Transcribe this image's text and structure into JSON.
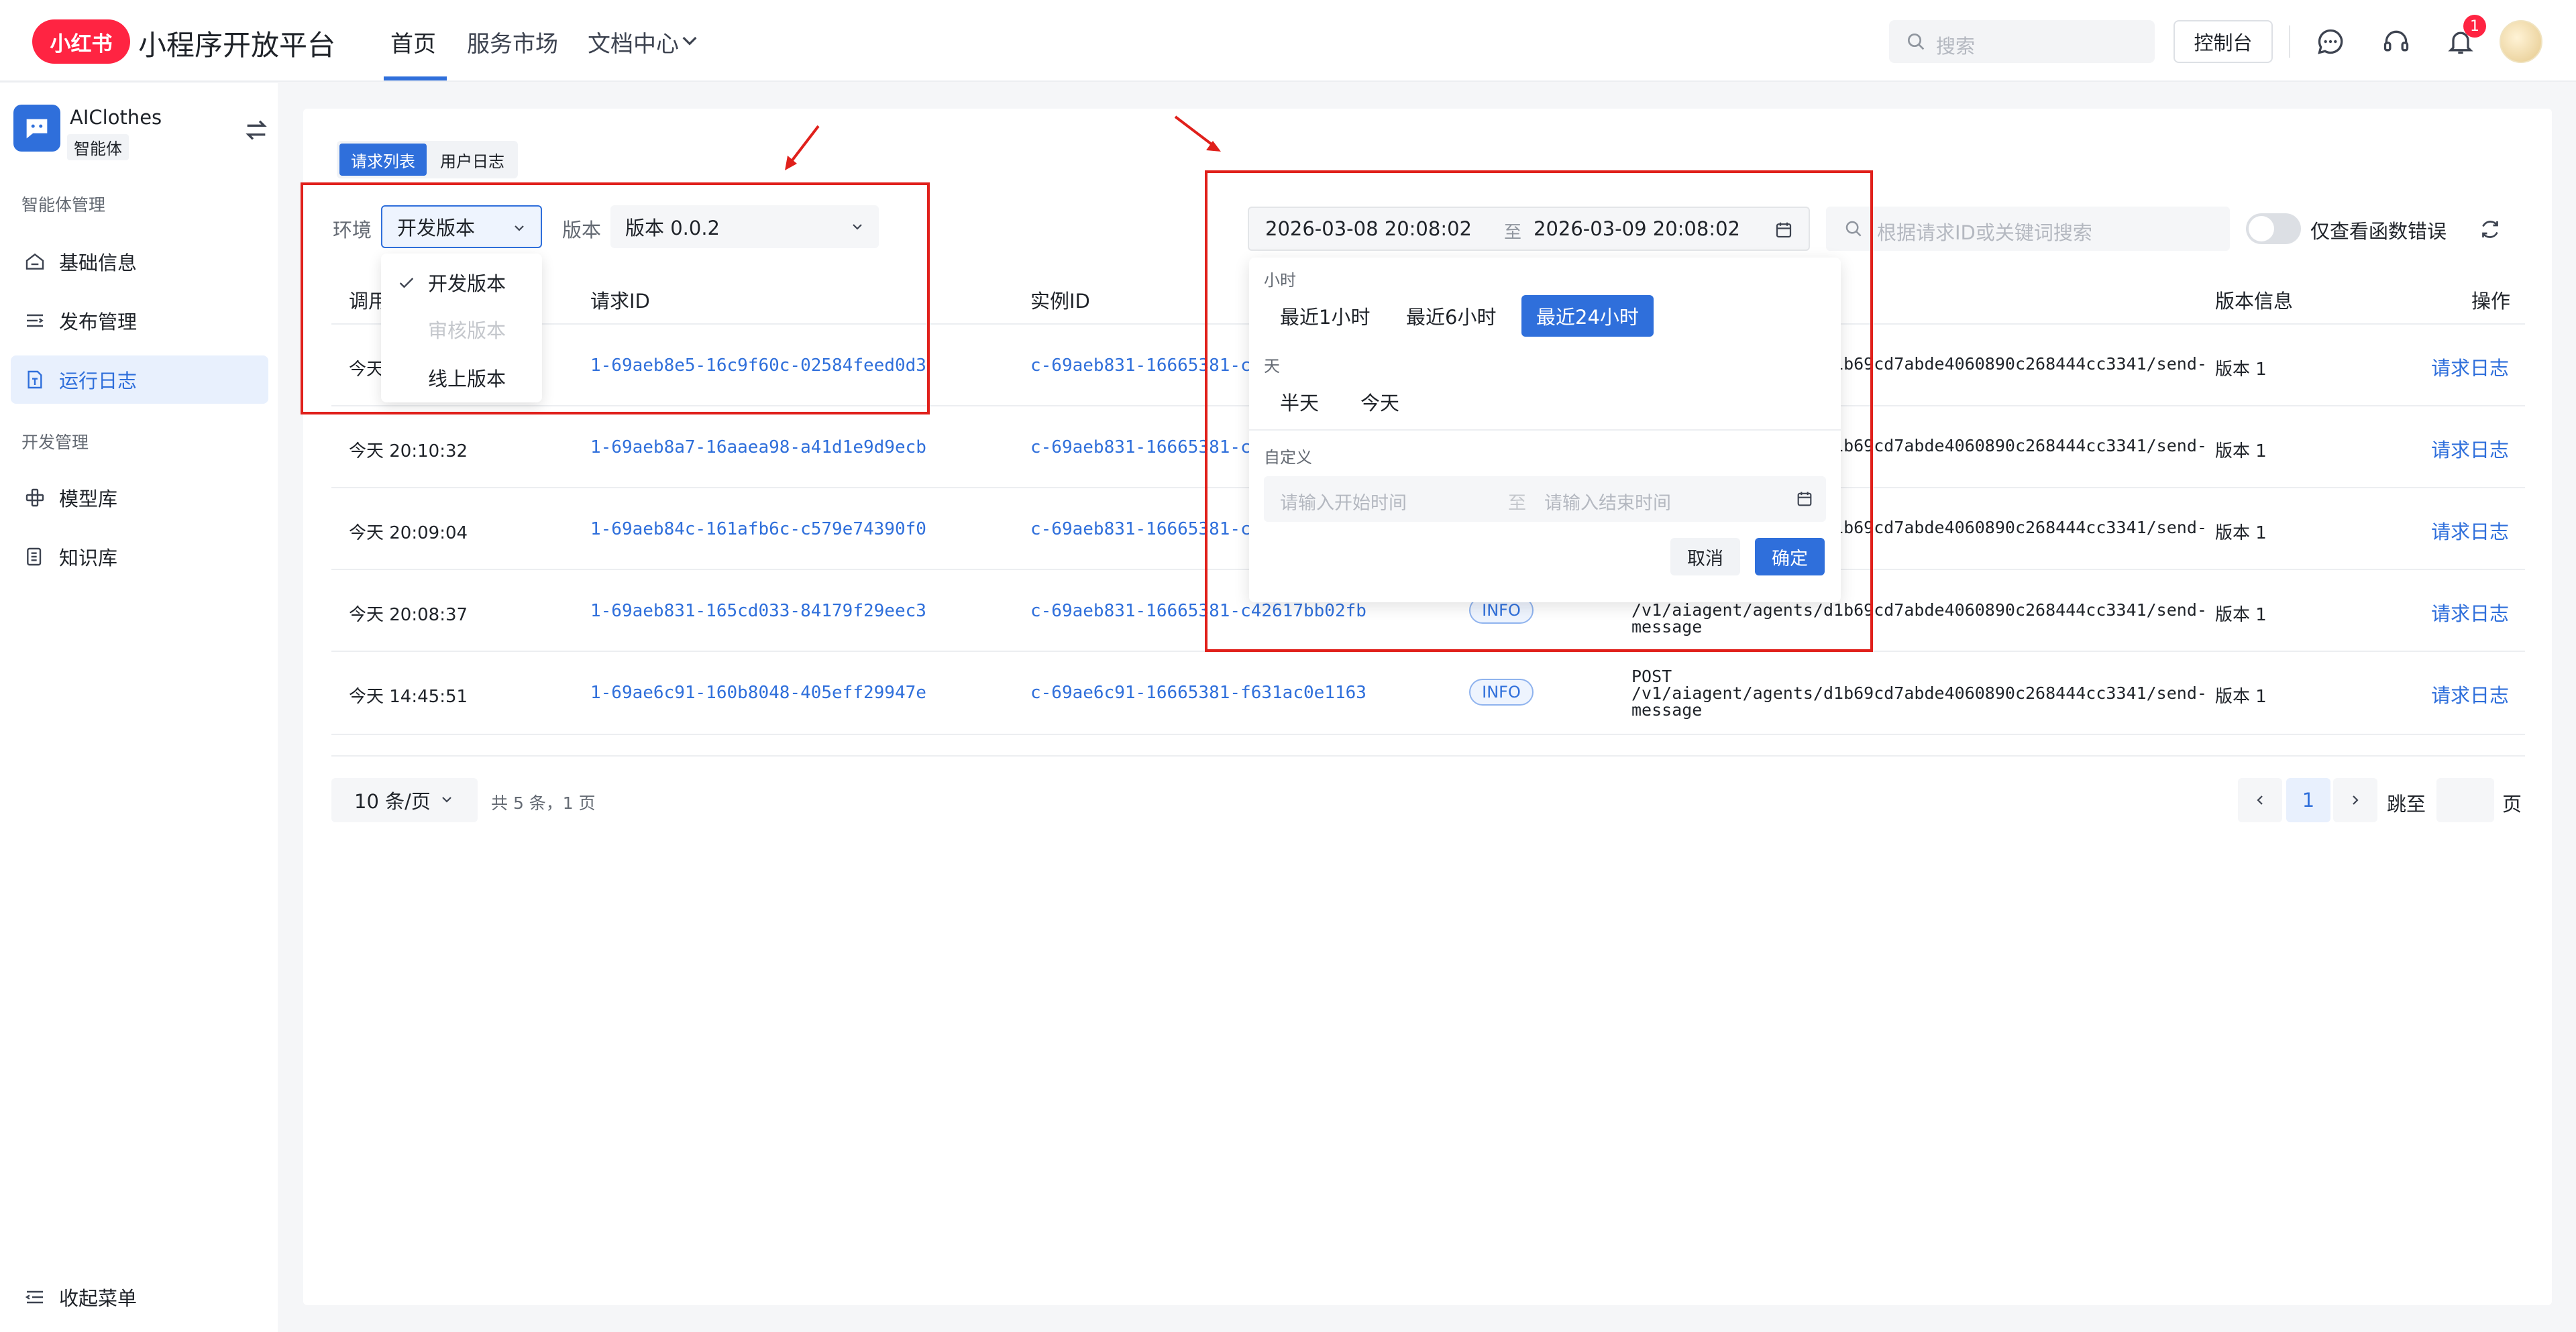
{
  "header": {
    "logo_text": "小红书",
    "platform_title": "小程序开放平台",
    "nav": [
      "首页",
      "服务市场",
      "文档中心"
    ],
    "search_placeholder": "搜索",
    "console_label": "控制台",
    "notification_count": "1"
  },
  "sidebar": {
    "agent_name": "AIClothes",
    "agent_tag": "智能体",
    "group1": "智能体管理",
    "items1": [
      "基础信息",
      "发布管理",
      "运行日志"
    ],
    "group2": "开发管理",
    "items2": [
      "模型库",
      "知识库"
    ],
    "collapse": "收起菜单"
  },
  "tabs": [
    "请求列表",
    "用户日志"
  ],
  "filters": {
    "env_label": "环境",
    "env_value": "开发版本",
    "env_options": [
      "开发版本",
      "审核版本",
      "线上版本"
    ],
    "version_label": "版本",
    "version_value": "版本 0.0.2",
    "range_start": "2026-03-08 20:08:02",
    "range_sep": "至",
    "range_end": "2026-03-09 20:08:02",
    "keyword_placeholder": "根据请求ID或关键词搜索",
    "errors_only_label": "仅查看函数错误"
  },
  "time_popup": {
    "hour_label": "小时",
    "hour_options": [
      "最近1小时",
      "最近6小时",
      "最近24小时"
    ],
    "day_label": "天",
    "day_options": [
      "半天",
      "今天"
    ],
    "custom_label": "自定义",
    "start_placeholder": "请输入开始时间",
    "sep": "至",
    "end_placeholder": "请输入结束时间",
    "cancel": "取消",
    "confirm": "确定"
  },
  "table": {
    "headers": [
      "调用结束时间",
      "请求ID",
      "实例ID",
      "版本信息",
      "操作"
    ],
    "rows": [
      {
        "time": "今天 20:11:09",
        "req": "1-69aeb8e5-16c9f60c-02584feed0d3",
        "inst": "c-69aeb831-16665381-c42617bb02fb",
        "level": "",
        "method": "",
        "path1": "/v1/aiagent/agents/d1b69cd7abde4060890c268444cc3341/send-",
        "path2": "",
        "ver": "版本 1",
        "op": "请求日志"
      },
      {
        "time": "今天 20:10:32",
        "req": "1-69aeb8a7-16aaea98-a41d1e9d9ecb",
        "inst": "c-69aeb831-16665381-c42617bb02fb",
        "level": "",
        "method": "",
        "path1": "/v1/aiagent/agents/d1b69cd7abde4060890c268444cc3341/send-",
        "path2": "",
        "ver": "版本 1",
        "op": "请求日志"
      },
      {
        "time": "今天 20:09:04",
        "req": "1-69aeb84c-161afb6c-c579e74390f0",
        "inst": "c-69aeb831-16665381-c42617bb02fb",
        "level": "",
        "method": "",
        "path1": "/v1/aiagent/agents/d1b69cd7abde4060890c268444cc3341/send-",
        "path2": "",
        "ver": "版本 1",
        "op": "请求日志"
      },
      {
        "time": "今天 20:08:37",
        "req": "1-69aeb831-165cd033-84179f29eec3",
        "inst": "c-69aeb831-16665381-c42617bb02fb",
        "level": "INFO",
        "method": "",
        "path1": "/v1/aiagent/agents/d1b69cd7abde4060890c268444cc3341/send-",
        "path2": "message",
        "ver": "版本 1",
        "op": "请求日志"
      },
      {
        "time": "今天 14:45:51",
        "req": "1-69ae6c91-160b8048-405eff29947e",
        "inst": "c-69ae6c91-16665381-f631ac0e1163",
        "level": "INFO",
        "method": "POST",
        "path1": "/v1/aiagent/agents/d1b69cd7abde4060890c268444cc3341/send-",
        "path2": "message",
        "ver": "版本 1",
        "op": "请求日志"
      }
    ]
  },
  "pagination": {
    "page_size": "10 条/页",
    "total": "共 5 条，1 页",
    "current": "1",
    "jump": "跳至",
    "page": "页"
  },
  "colors": {
    "accent": "#2f6fdb",
    "brand": "#ff2442",
    "annotation": "#e0201b"
  }
}
